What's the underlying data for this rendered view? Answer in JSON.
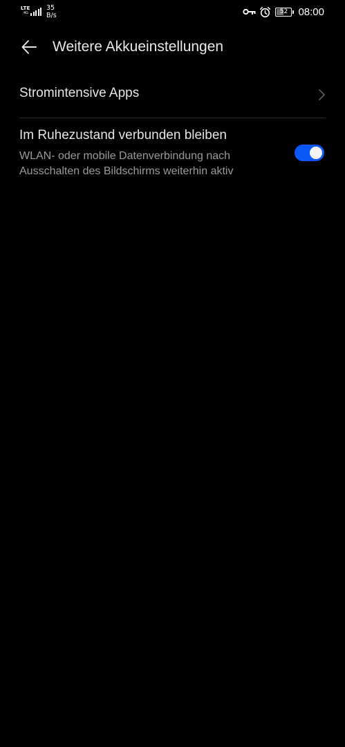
{
  "status_bar": {
    "network_type": "LTE",
    "network_sub": "4G",
    "signal_icon": "cellular-signal-icon",
    "speed_value": "35",
    "speed_unit": "B/s",
    "vpn_icon": "key-icon",
    "alarm_icon": "alarm-clock-icon",
    "battery_level": "52",
    "time": "08:00"
  },
  "header": {
    "back_icon": "arrow-left-icon",
    "title": "Weitere Akkueinstellungen"
  },
  "settings": {
    "apps_item": {
      "label": "Stromintensive Apps",
      "icon": "chevron-right-icon"
    },
    "stay_connected_item": {
      "title": "Im Ruhezustand verbunden bleiben",
      "description": "WLAN- oder mobile Datenverbindung nach Ausschalten des Bildschirms weiterhin aktiv",
      "toggle_on": true,
      "toggle_color": "#0a59f7"
    }
  },
  "colors": {
    "background": "#000000",
    "primary_text": "#e4e4e4",
    "secondary_text": "#9a9a9a",
    "accent": "#0a59f7"
  }
}
